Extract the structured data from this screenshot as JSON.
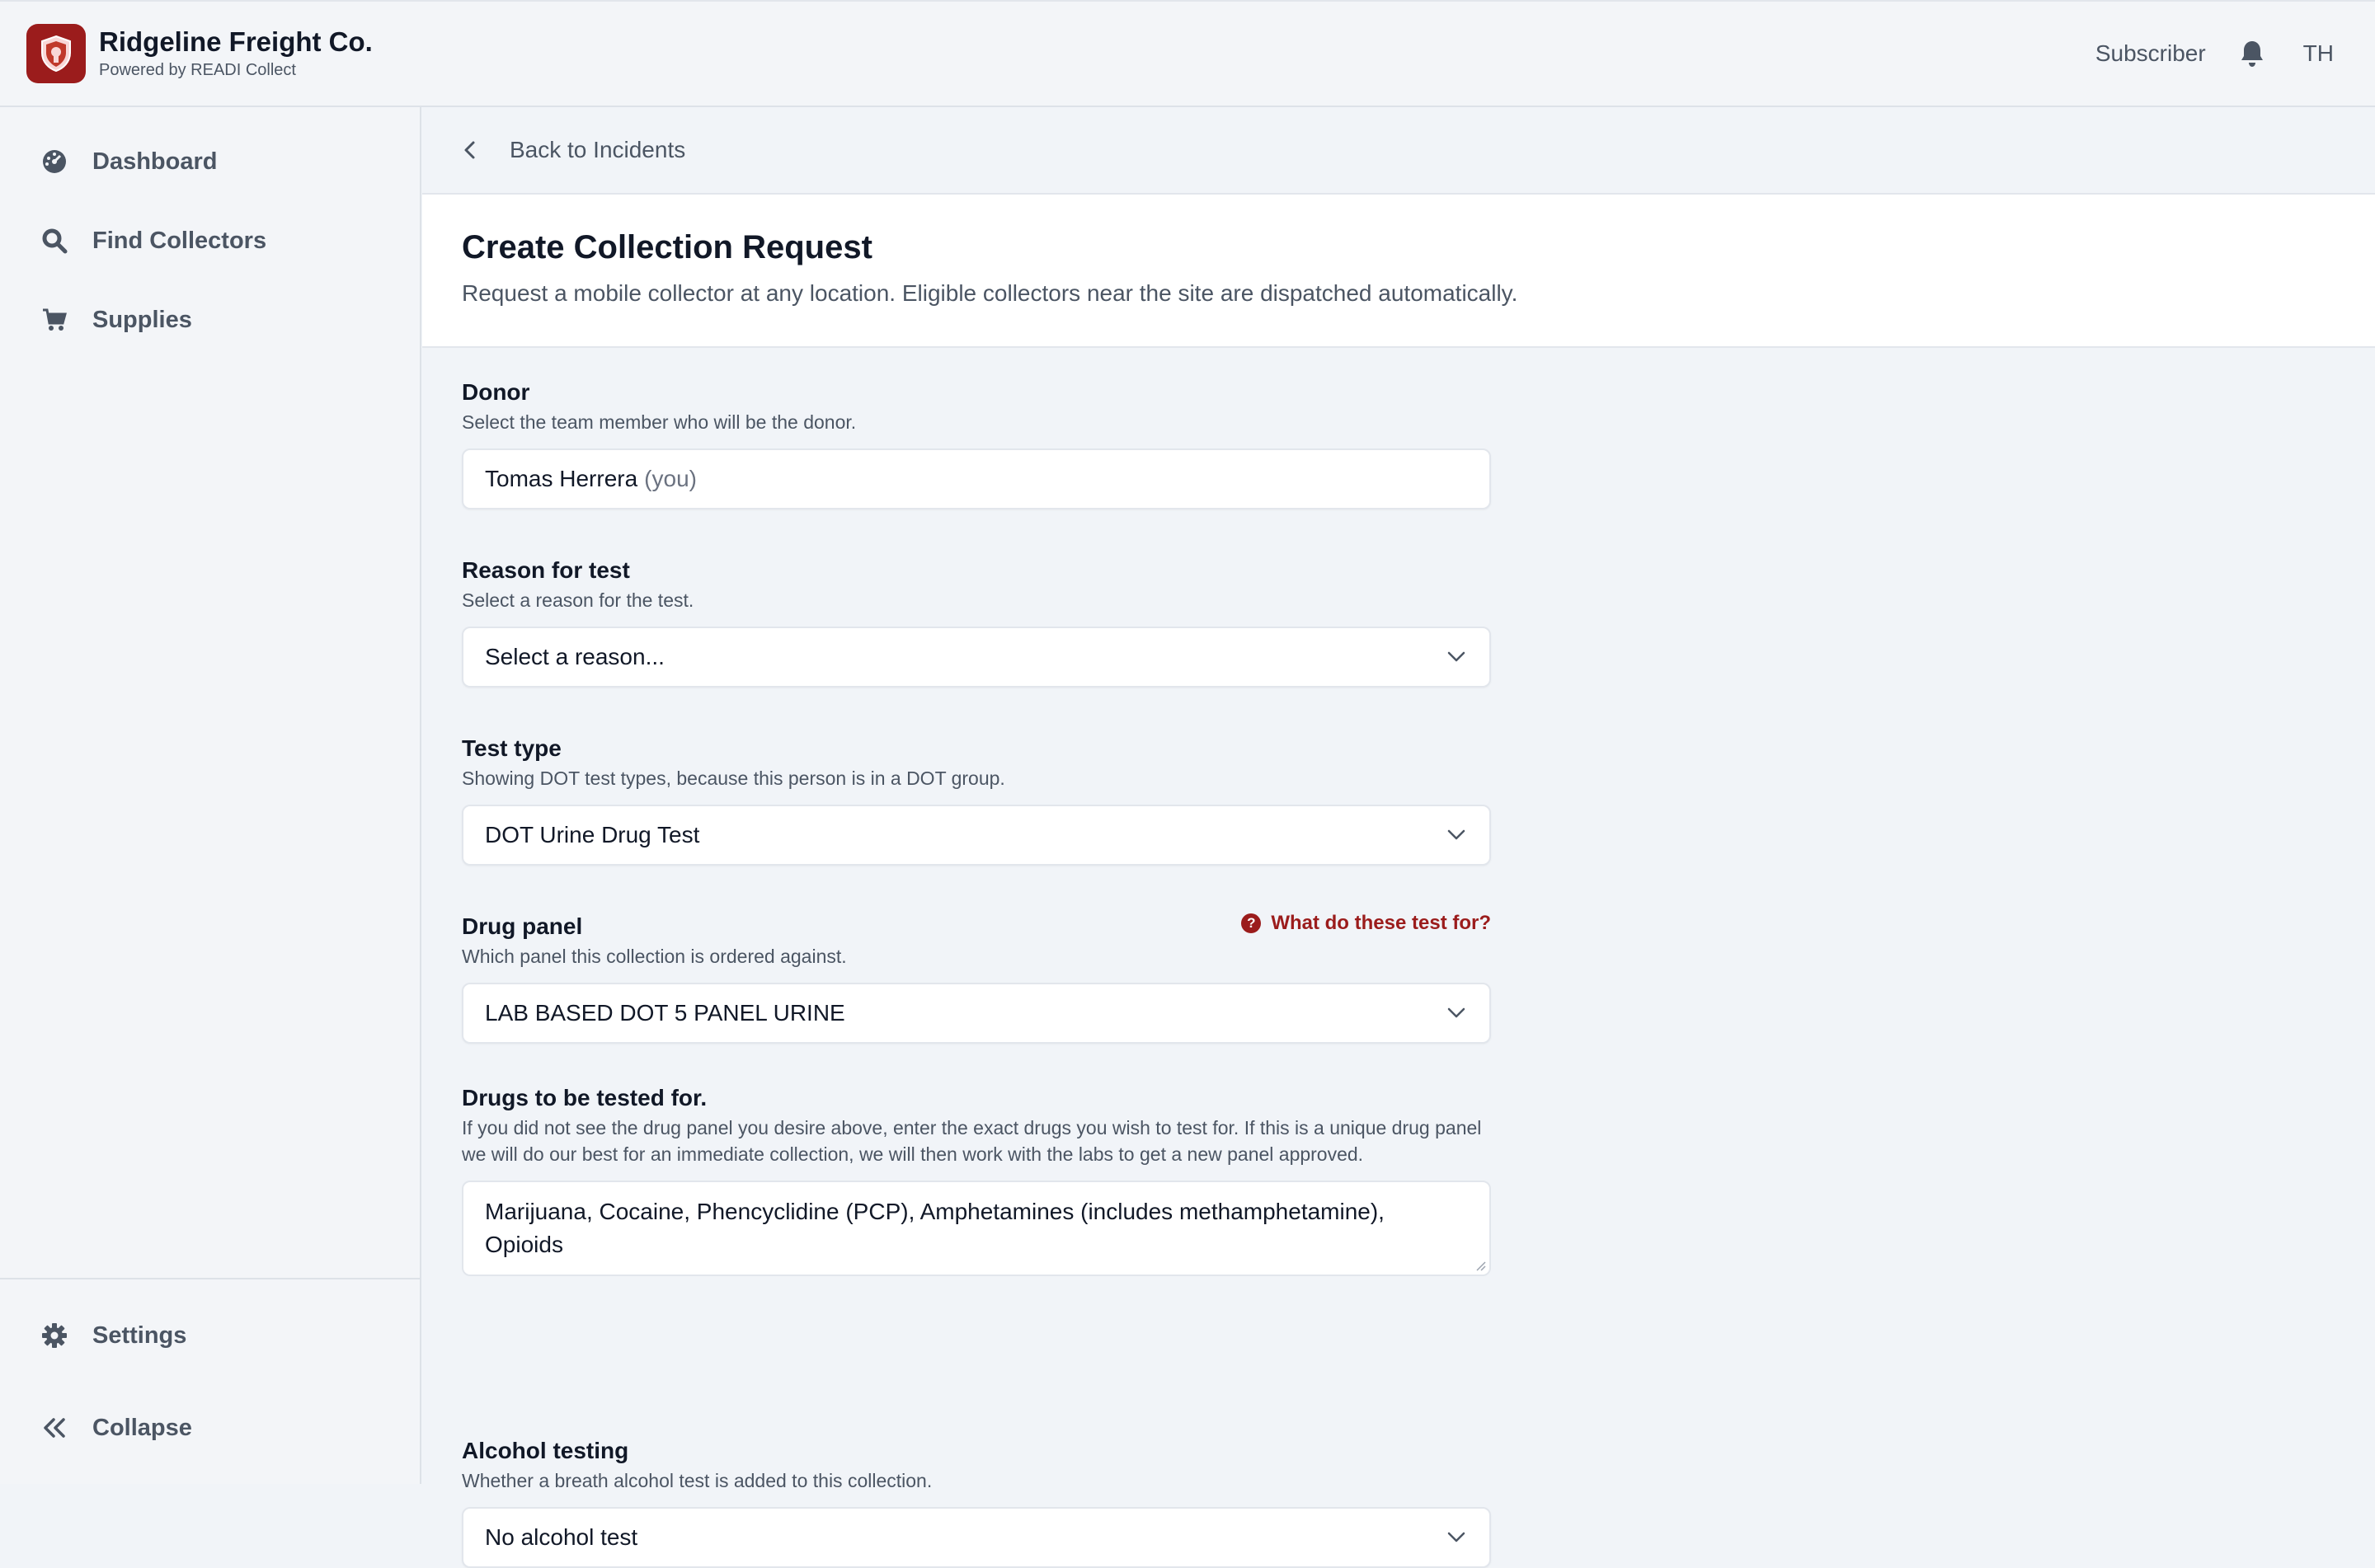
{
  "header": {
    "brand_name": "Ridgeline Freight Co.",
    "brand_sub": "Powered by READI Collect",
    "role": "Subscriber",
    "avatar_initials": "TH",
    "brand_color": "#9b1c1c"
  },
  "sidebar": {
    "items": [
      {
        "label": "Dashboard",
        "icon": "dashboard-icon"
      },
      {
        "label": "Find Collectors",
        "icon": "search-icon"
      },
      {
        "label": "Supplies",
        "icon": "cart-icon"
      }
    ],
    "bottom": [
      {
        "label": "Settings",
        "icon": "gear-icon"
      },
      {
        "label": "Collapse",
        "icon": "double-chevron-left-icon"
      }
    ]
  },
  "main": {
    "back_label": "Back to Incidents",
    "title": "Create Collection Request",
    "description": "Request a mobile collector at any location. Eligible collectors near the site are dispatched automatically.",
    "fields": {
      "donor": {
        "label": "Donor",
        "help": "Select the team member who will be the donor.",
        "value": "Tomas Herrera",
        "suffix": "(you)"
      },
      "reason": {
        "label": "Reason for test",
        "help": "Select a reason for the test.",
        "value": "Select a reason..."
      },
      "test_type": {
        "label": "Test type",
        "help": "Showing DOT test types, because this person is in a DOT group.",
        "value": "DOT Urine Drug Test"
      },
      "drug_panel": {
        "label": "Drug panel",
        "help": "Which panel this collection is ordered against.",
        "help_link": "What do these test for?",
        "value": "LAB BASED DOT 5 PANEL URINE"
      },
      "drugs": {
        "label": "Drugs to be tested for.",
        "help": "If you did not see the drug panel you desire above, enter the exact drugs you wish to test for. If this is a unique drug panel we will do our best for an immediate collection, we will then work with the labs to get a new panel approved.",
        "value": "Marijuana, Cocaine, Phencyclidine (PCP), Amphetamines (includes methamphetamine), Opioids"
      },
      "alcohol": {
        "label": "Alcohol testing",
        "help": "Whether a breath alcohol test is added to this collection.",
        "value": "No alcohol test"
      }
    }
  }
}
